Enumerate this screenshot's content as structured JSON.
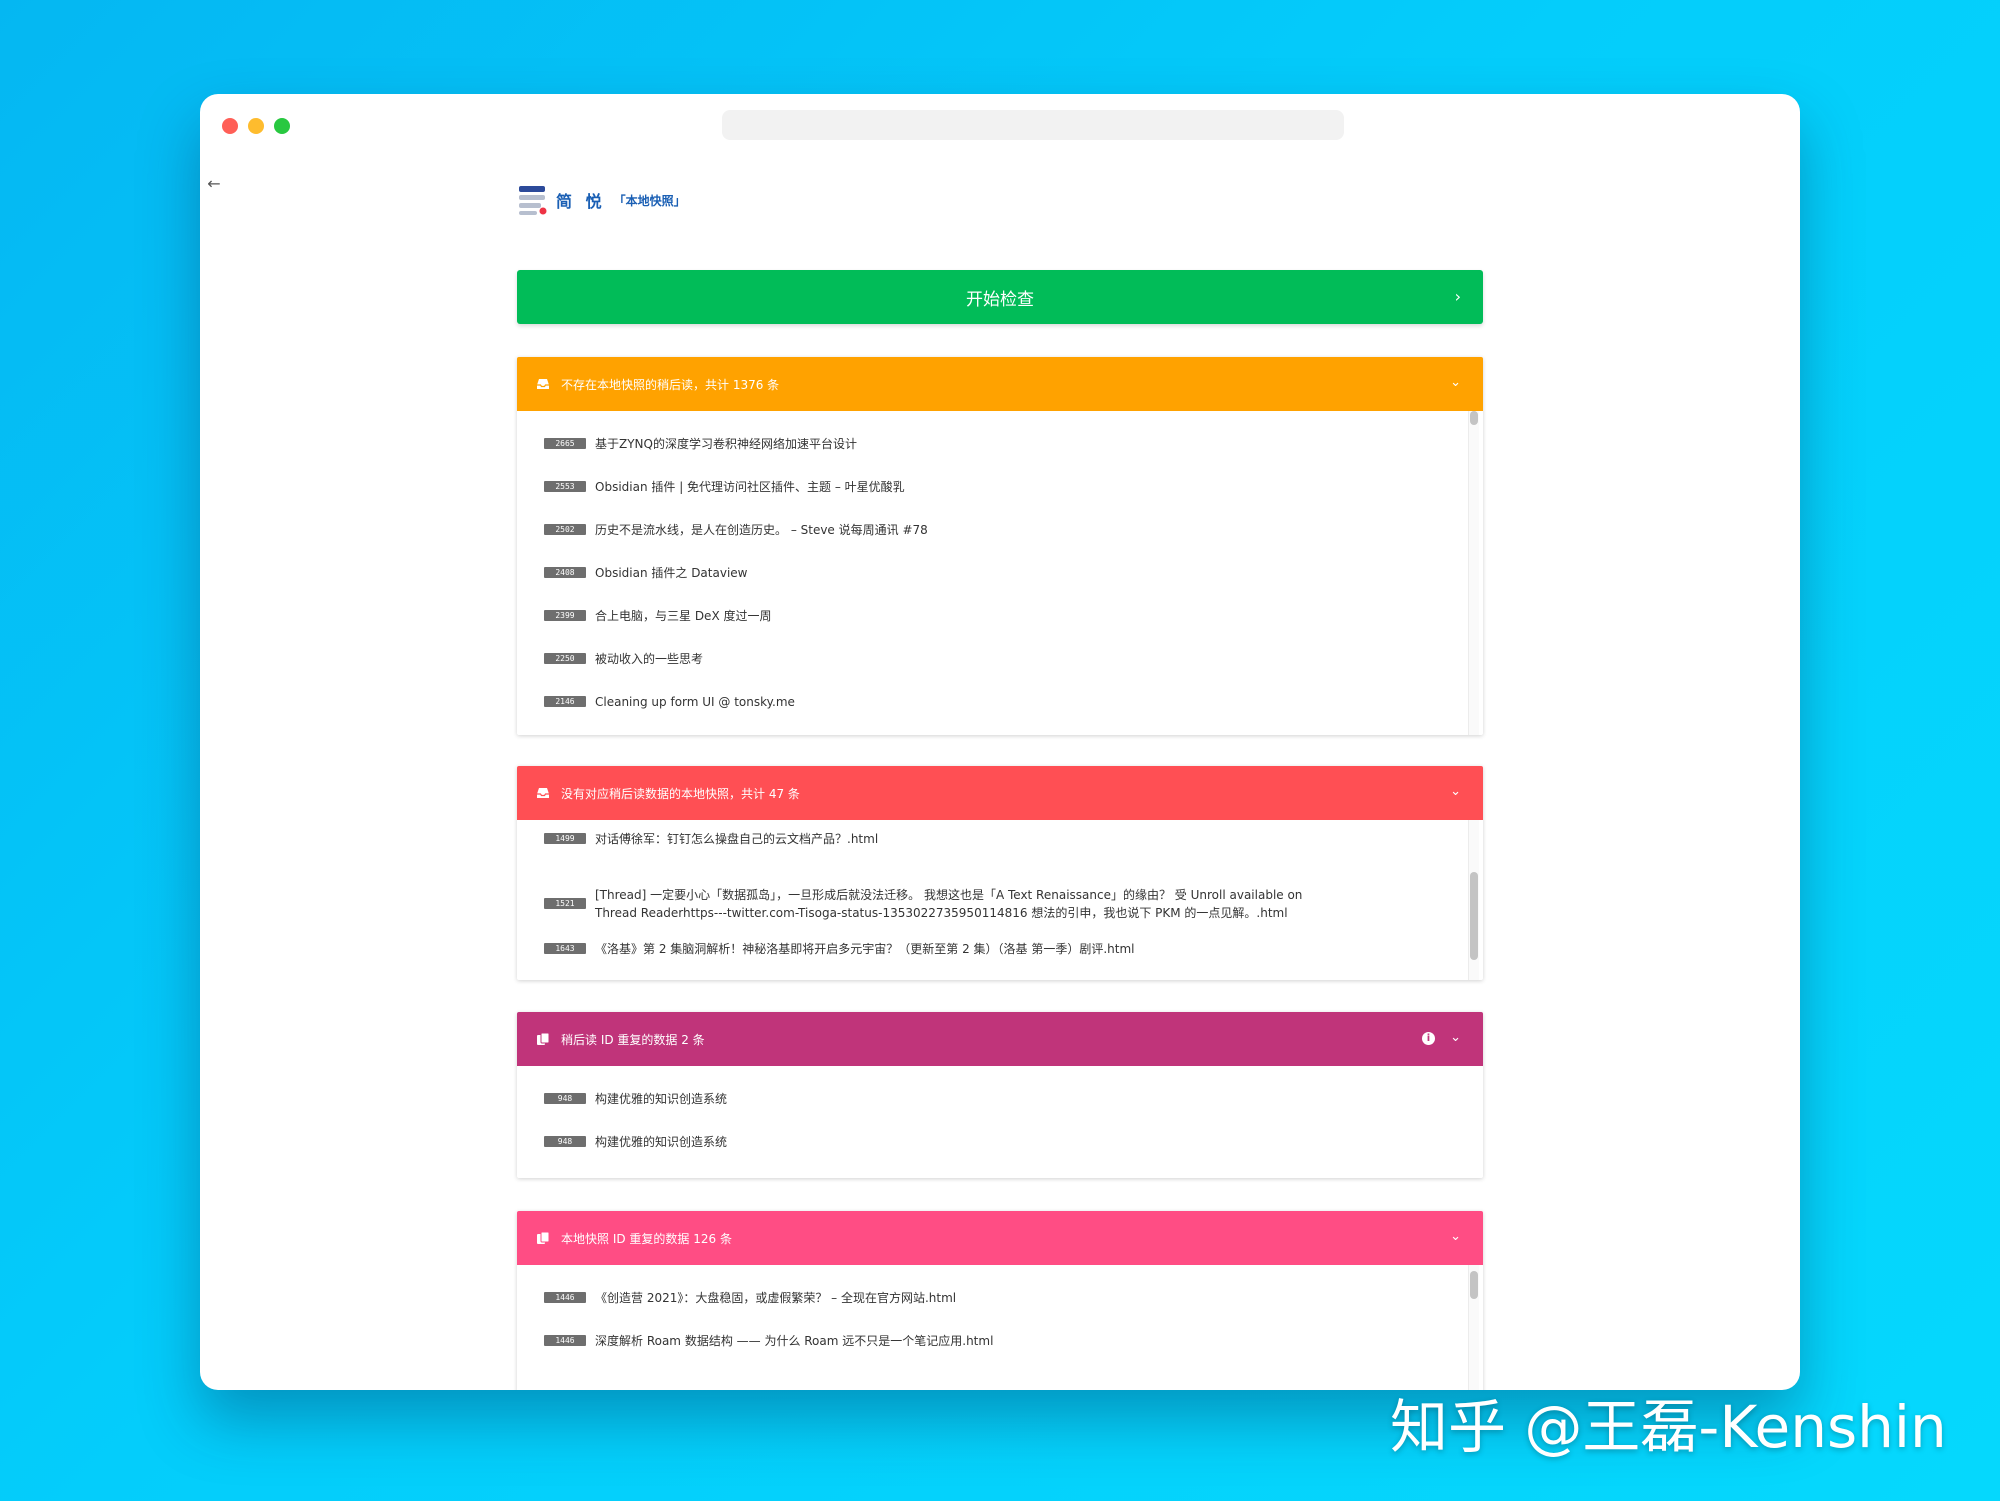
{
  "app": {
    "logo_title": "简 悦",
    "logo_subtitle": "「本地快照」"
  },
  "start_button": {
    "label": "开始检查"
  },
  "colors": {
    "green": "#01bc58",
    "orange": "#ffa200",
    "red": "#ff4f54",
    "magenta": "#c0347a",
    "pink": "#ff4d84"
  },
  "sections": [
    {
      "title": "不存在本地快照的稍后读，共计 1376 条",
      "icon": "inbox-icon",
      "items": [
        {
          "id": "2665",
          "text": "基于ZYNQ的深度学习卷积神经网络加速平台设计"
        },
        {
          "id": "2553",
          "text": "Obsidian 插件 | 免代理访问社区插件、主题 – 叶星优酸乳"
        },
        {
          "id": "2502",
          "text": "历史不是流水线，是人在创造历史。 – Steve 说每周通讯 #78"
        },
        {
          "id": "2408",
          "text": "Obsidian 插件之 Dataview"
        },
        {
          "id": "2399",
          "text": "合上电脑，与三星 DeX 度过一周"
        },
        {
          "id": "2250",
          "text": "被动收入的一些思考"
        },
        {
          "id": "2146",
          "text": "Cleaning up form UI @ tonsky.me"
        }
      ]
    },
    {
      "title": "没有对应稍后读数据的本地快照，共计 47 条",
      "icon": "inbox-icon",
      "items": [
        {
          "id": "1499",
          "text": "对话傅徐军：钉钉怎么操盘自己的云文档产品？.html"
        },
        {
          "id": "1521",
          "text": "[Thread] 一定要小心「数据孤岛」，一旦形成后就没法迁移。 我想这也是「A Text Renaissance」的缘由？ 受 Unroll available on Thread Readerhttps---twitter.com-Tisoga-status-1353022735950114816 想法的引申，我也说下 PKM 的一点见解。.html"
        },
        {
          "id": "1643",
          "text": "《洛基》第 2 集脑洞解析！神秘洛基即将开启多元宇宙？（更新至第 2 集）（洛基 第一季）剧评.html"
        }
      ]
    },
    {
      "title": "稍后读 ID 重复的数据 2 条",
      "icon": "copy-icon",
      "items": [
        {
          "id": "948",
          "text": "构建优雅的知识创造系统"
        },
        {
          "id": "948",
          "text": "构建优雅的知识创造系统"
        }
      ]
    },
    {
      "title": "本地快照 ID 重复的数据 126 条",
      "icon": "copy-icon",
      "items": [
        {
          "id": "1446",
          "text": "《创造营 2021》：大盘稳固，或虚假繁荣？ – 全现在官方网站.html"
        },
        {
          "id": "1446",
          "text": "深度解析 Roam 数据结构 —— 为什么 Roam 远不只是一个笔记应用.html"
        }
      ]
    }
  ],
  "watermark": "知乎 @王磊-Kenshin"
}
